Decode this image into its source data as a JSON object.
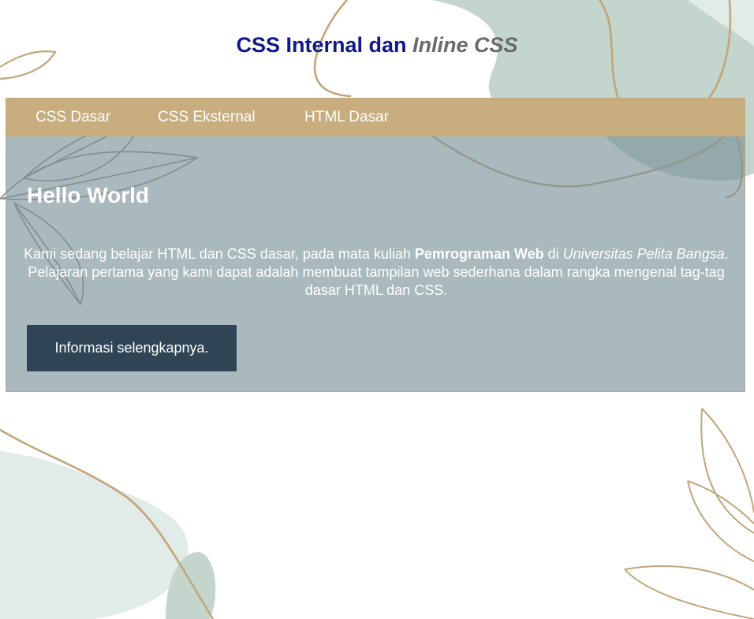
{
  "header": {
    "title_main": "CSS Internal dan ",
    "title_accent": "Inline CSS"
  },
  "nav": {
    "items": [
      {
        "label": "CSS Dasar"
      },
      {
        "label": "CSS Eksternal"
      },
      {
        "label": "HTML Dasar"
      }
    ]
  },
  "hero": {
    "heading": "Hello World",
    "paragraph": {
      "part1": "Kami sedang belajar HTML dan CSS dasar, pada mata kuliah ",
      "course_bold": "Pemrograman Web",
      "part2": " di ",
      "university_italic": "Universitas Pelita Bangsa",
      "part3": ". Pelajaran pertama yang kami dapat adalah membuat tampilan web sederhana dalam rangka mengenal tag-tag dasar HTML dan CSS."
    },
    "button_label": "Informasi selengkapnya."
  },
  "colors": {
    "title": "#10188a",
    "title_accent": "#6a6a6a",
    "nav_background": "#c8ad7f",
    "hero_overlay": "#a2b3b7",
    "button_background": "#2f4555",
    "leaf_line": "#c2a57a",
    "blob_sage": "#c4d5cd",
    "blob_light": "#e1ebe7"
  }
}
